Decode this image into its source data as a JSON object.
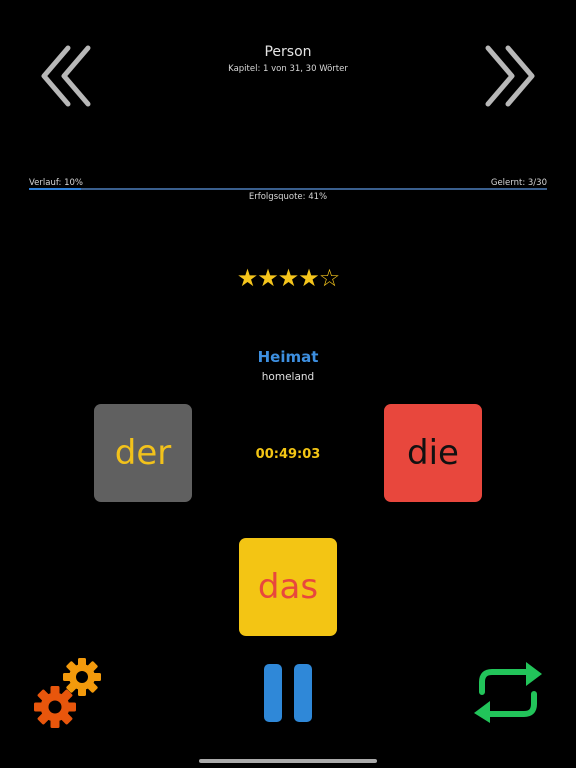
{
  "header": {
    "title": "Person",
    "subtitle": "Kapitel: 1 von 31, 30 Wörter"
  },
  "progress": {
    "label": "Verlauf: 10%",
    "value": 0.1,
    "learned_label": "Gelernt: 3/30",
    "success_label": "Erfolgsquote: 41%"
  },
  "rating": {
    "filled": 4,
    "total": 5,
    "filled_glyph": "★",
    "empty_glyph": "☆"
  },
  "card": {
    "word": "Heimat",
    "translation": "homeland"
  },
  "articles": {
    "der": "der",
    "die": "die",
    "das": "das"
  },
  "timer": "00:49:03",
  "colors": {
    "background": "#000000",
    "accent_blue": "#2f80d8",
    "star_yellow": "#f5c51c",
    "der_bg": "#606060",
    "die_bg": "#e8473d",
    "das_bg": "#f3c514",
    "settings_orange": "#f07d0a",
    "repeat_green": "#22c45a"
  },
  "icons": {
    "prev": "double-chevron-left-icon",
    "next": "double-chevron-right-icon",
    "settings": "gears-icon",
    "pause": "pause-icon",
    "repeat": "repeat-icon"
  }
}
